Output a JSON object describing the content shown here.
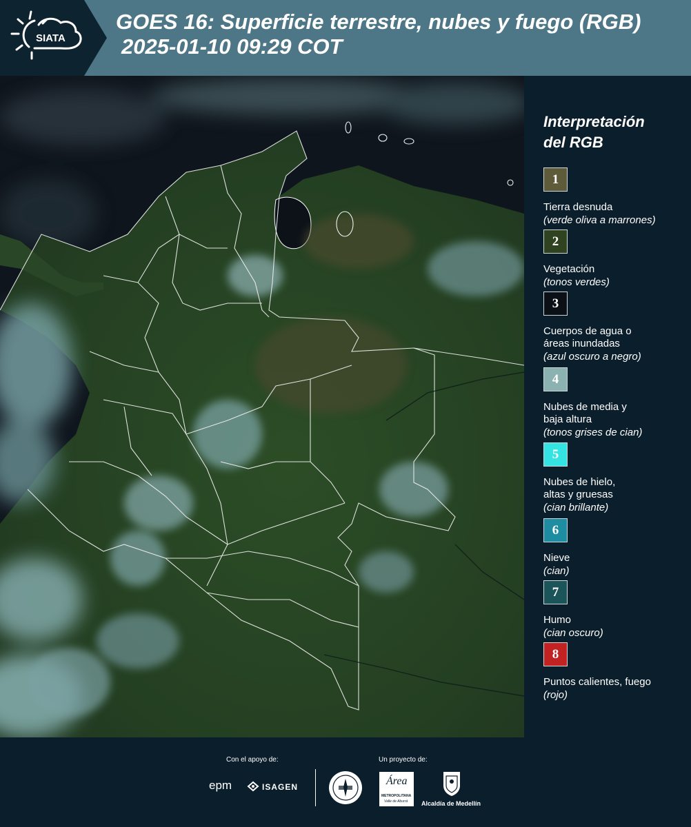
{
  "header": {
    "logo_text": "SIATA",
    "title_line1": "GOES 16: Superficie terrestre, nubes y fuego (RGB)",
    "title_line2": "2025-01-10 09:29 COT"
  },
  "legend": {
    "title_line1": "Interpretación",
    "title_line2": "del RGB",
    "items": [
      {
        "num": "1",
        "color": "#5e5b3b",
        "label": [
          "Tierra desnuda"
        ],
        "sub": "(verde oliva a marrones)"
      },
      {
        "num": "2",
        "color": "#2f4320",
        "label": [
          "Vegetación"
        ],
        "sub": "(tonos verdes)"
      },
      {
        "num": "3",
        "color": "#0b1017",
        "label": [
          "Cuerpos de agua o",
          "áreas inundadas"
        ],
        "sub": "(azul oscuro a negro)"
      },
      {
        "num": "4",
        "color": "#8cb1b1",
        "label": [
          "Nubes de media y",
          "baja altura"
        ],
        "sub": "(tonos grises de cian)"
      },
      {
        "num": "5",
        "color": "#33e4e2",
        "label": [
          "Nubes de hielo,",
          "altas y gruesas"
        ],
        "sub": "(cian brillante)"
      },
      {
        "num": "6",
        "color": "#1f8da1",
        "label": [
          "Nieve"
        ],
        "sub": "(cian)"
      },
      {
        "num": "7",
        "color": "#1c5559",
        "label": [
          "Humo"
        ],
        "sub": "(cian oscuro)"
      },
      {
        "num": "8",
        "color": "#c22221",
        "label": [
          "Puntos calientes, fuego"
        ],
        "sub": "(rojo)"
      }
    ]
  },
  "footer": {
    "support_label": "Con el apoyo de:",
    "project_label": "Un proyecto de:",
    "sponsor_epm": "epm",
    "sponsor_isagen": "ISAGEN",
    "sponsor_area": "Área",
    "sponsor_area_sub": "METROPOLITANA",
    "sponsor_area_sub2": "Valle de Aburrá",
    "sponsor_alcaldia": "Alcaldía de Medellín"
  }
}
